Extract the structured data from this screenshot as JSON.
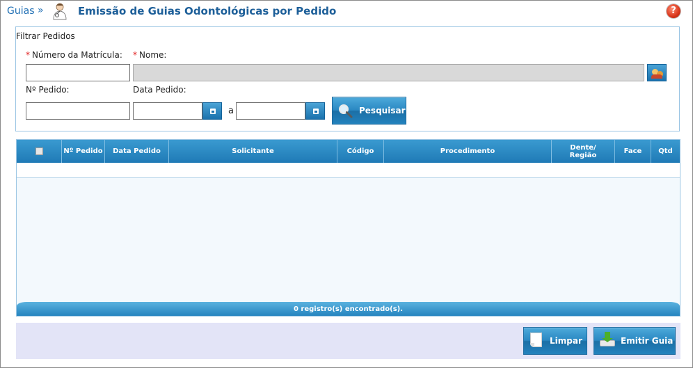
{
  "header": {
    "breadcrumb": "Guias",
    "breadcrumb_sep": "»",
    "title": "Emissão de Guias Odontológicas por Pedido",
    "help_icon": "help-icon",
    "help_glyph": "?"
  },
  "filter": {
    "legend": "Filtrar Pedidos",
    "required_mark": "*",
    "matricula_label": "Número da Matrícula:",
    "matricula_value": "",
    "nome_label": "Nome:",
    "nome_value": "",
    "pedido_label": "Nº Pedido:",
    "pedido_value": "",
    "data_label": "Data Pedido:",
    "data_from": "",
    "data_to": "",
    "range_sep": "a",
    "search_label": "Pesquisar"
  },
  "grid": {
    "columns": [
      "",
      "Nº Pedido",
      "Data Pedido",
      "Solicitante",
      "Código",
      "Procedimento",
      "Dente/ Região",
      "Face",
      "Qtd"
    ],
    "rows": [],
    "footer": "0 registro(s) encontrado(s)."
  },
  "actions": {
    "clear_label": "Limpar",
    "emit_label": "Emitir Guia"
  },
  "colors": {
    "accent": "#1f7ab6",
    "title": "#1d5f99",
    "action_bar": "#e3e4f7"
  }
}
